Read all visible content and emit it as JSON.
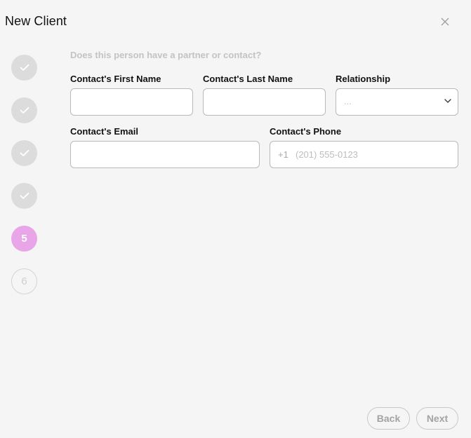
{
  "modal": {
    "title": "New Client"
  },
  "stepper": {
    "steps": [
      {
        "state": "done",
        "label": ""
      },
      {
        "state": "done",
        "label": ""
      },
      {
        "state": "done",
        "label": ""
      },
      {
        "state": "done",
        "label": ""
      },
      {
        "state": "active",
        "label": "5"
      },
      {
        "state": "todo",
        "label": "6"
      }
    ]
  },
  "form": {
    "question": "Does this person have a partner or contact?",
    "first_name": {
      "label": "Contact's First Name",
      "value": ""
    },
    "last_name": {
      "label": "Contact's Last Name",
      "value": ""
    },
    "relationship": {
      "label": "Relationship",
      "selected": "..."
    },
    "email": {
      "label": "Contact's Email",
      "value": ""
    },
    "phone": {
      "label": "Contact's Phone",
      "prefix": "+1",
      "placeholder": "(201) 555-0123",
      "value": ""
    }
  },
  "footer": {
    "back_label": "Back",
    "next_label": "Next"
  },
  "colors": {
    "accent": "#e8a5e8",
    "step_done": "#dcdcdc",
    "muted_text": "#c3c3c3"
  }
}
